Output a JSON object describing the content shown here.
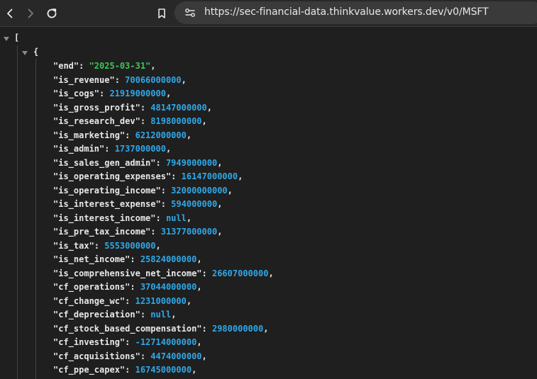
{
  "browser": {
    "url": "https://sec-financial-data.thinkvalue.workers.dev/v0/MSFT",
    "icons": {
      "back": "chevron-left-icon",
      "forward": "chevron-right-icon",
      "reload": "reload-icon",
      "bookmark": "bookmark-icon",
      "site_info": "site-settings-icon"
    }
  },
  "json": {
    "open_bracket": "[",
    "open_brace": "{",
    "entries": [
      {
        "key": "\"end\"",
        "value": "\"2025-03-31\"",
        "type": "string"
      },
      {
        "key": "\"is_revenue\"",
        "value": "70066000000",
        "type": "number"
      },
      {
        "key": "\"is_cogs\"",
        "value": "21919000000",
        "type": "number"
      },
      {
        "key": "\"is_gross_profit\"",
        "value": "48147000000",
        "type": "number"
      },
      {
        "key": "\"is_research_dev\"",
        "value": "8198000000",
        "type": "number"
      },
      {
        "key": "\"is_marketing\"",
        "value": "6212000000",
        "type": "number"
      },
      {
        "key": "\"is_admin\"",
        "value": "1737000000",
        "type": "number"
      },
      {
        "key": "\"is_sales_gen_admin\"",
        "value": "7949000000",
        "type": "number"
      },
      {
        "key": "\"is_operating_expenses\"",
        "value": "16147000000",
        "type": "number"
      },
      {
        "key": "\"is_operating_income\"",
        "value": "32000000000",
        "type": "number"
      },
      {
        "key": "\"is_interest_expense\"",
        "value": "594000000",
        "type": "number"
      },
      {
        "key": "\"is_interest_income\"",
        "value": "null",
        "type": "null"
      },
      {
        "key": "\"is_pre_tax_income\"",
        "value": "31377000000",
        "type": "number"
      },
      {
        "key": "\"is_tax\"",
        "value": "5553000000",
        "type": "number"
      },
      {
        "key": "\"is_net_income\"",
        "value": "25824000000",
        "type": "number"
      },
      {
        "key": "\"is_comprehensive_net_income\"",
        "value": "26607000000",
        "type": "number"
      },
      {
        "key": "\"cf_operations\"",
        "value": "37044000000",
        "type": "number"
      },
      {
        "key": "\"cf_change_wc\"",
        "value": "1231000000",
        "type": "number"
      },
      {
        "key": "\"cf_depreciation\"",
        "value": "null",
        "type": "null"
      },
      {
        "key": "\"cf_stock_based_compensation\"",
        "value": "2980000000",
        "type": "number"
      },
      {
        "key": "\"cf_investing\"",
        "value": "-12714000000",
        "type": "number"
      },
      {
        "key": "\"cf_acquisitions\"",
        "value": "4474000000",
        "type": "number"
      },
      {
        "key": "\"cf_ppe_capex\"",
        "value": "16745000000",
        "type": "number"
      }
    ]
  },
  "colors": {
    "background": "#1f1f1f",
    "toolbar": "#282828",
    "urlbar": "#3a3a3a",
    "key": "#e8e8e8",
    "string": "#3ec65a",
    "number": "#2fa8e8"
  }
}
